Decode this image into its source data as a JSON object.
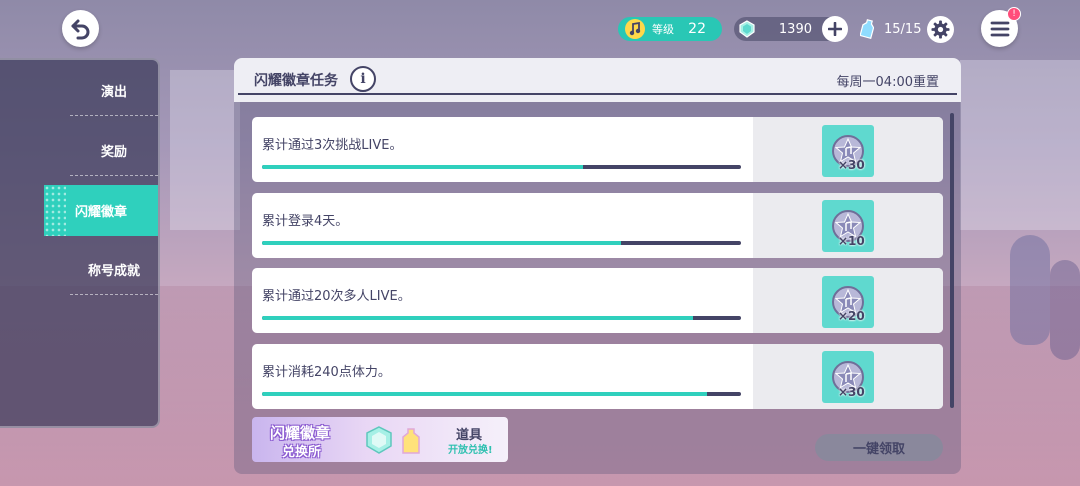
{
  "top_bar": {
    "level_label": "等级",
    "level_value": "22",
    "gem_value": "1390",
    "stamina_value": "15/15",
    "menu_badge": "!"
  },
  "side_menu": {
    "items": [
      {
        "label": "演出",
        "active": false
      },
      {
        "label": "奖励",
        "active": false
      },
      {
        "label": "闪耀徽章",
        "active": true
      },
      {
        "label": "称号成就",
        "active": false
      }
    ]
  },
  "panel": {
    "title": "闪耀徽章任务",
    "info_label": "i",
    "reset_text": "每周一04:00重置"
  },
  "missions": [
    {
      "text": "累计通过3次挑战LIVE。",
      "progress": 0.67,
      "reward_icon": "shine-badge-icon",
      "reward_count": "×30"
    },
    {
      "text": "累计登录4天。",
      "progress": 0.75,
      "reward_icon": "shine-badge-icon",
      "reward_count": "×10"
    },
    {
      "text": "累计通过20次多人LIVE。",
      "progress": 0.9,
      "reward_icon": "shine-badge-icon",
      "reward_count": "×20"
    },
    {
      "text": "累计消耗240点体力。",
      "progress": 0.93,
      "reward_icon": "shine-badge-icon",
      "reward_count": "×30"
    }
  ],
  "exchange_banner": {
    "title": "闪耀徽章",
    "subtitle": "兑换所",
    "right_line1": "道具",
    "right_line2": "开放兑换!"
  },
  "claim_all_label": "一键领取",
  "colors": {
    "accent": "#2fd0bd",
    "text_dark": "#444466",
    "panel_header": "#eeeef4",
    "badge_red": "#ff4d7a"
  }
}
